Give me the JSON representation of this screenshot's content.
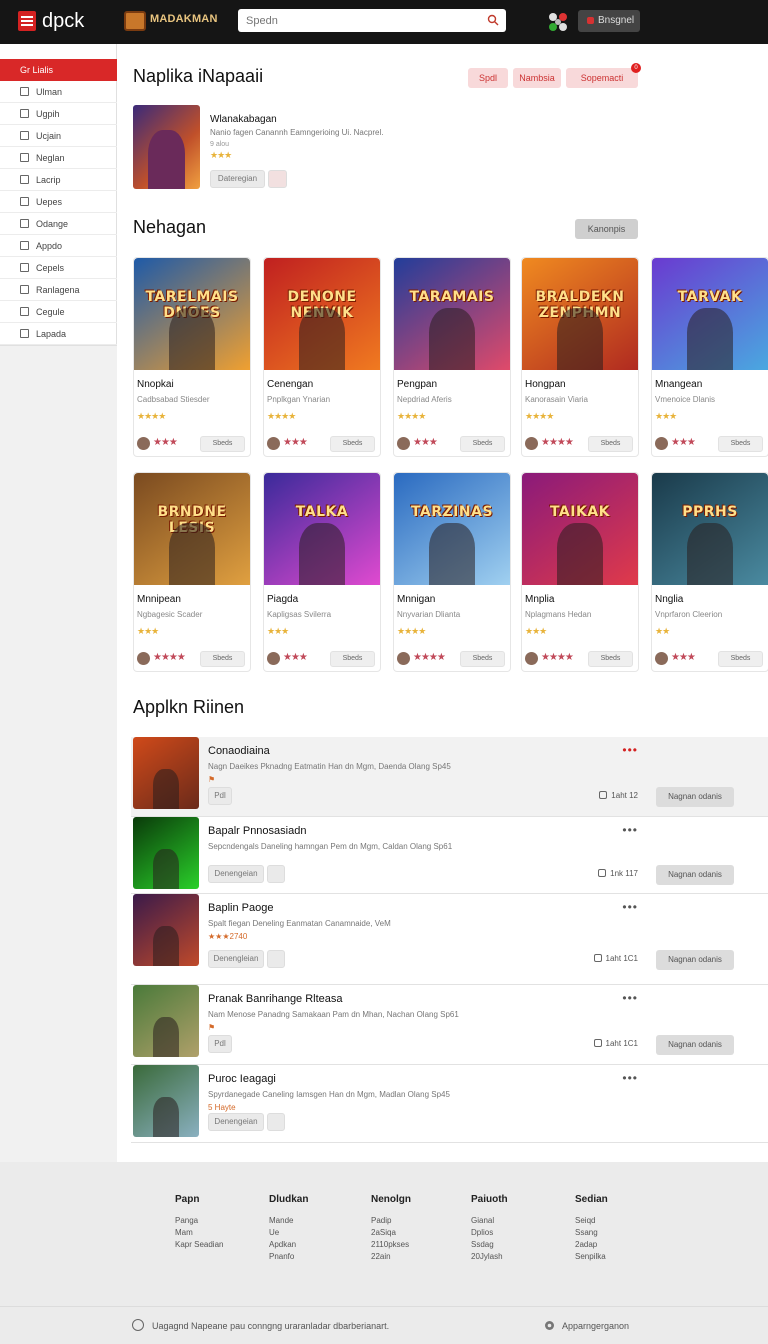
{
  "header": {
    "logo": "dpck",
    "brand": "MADAKMAN",
    "search_placeholder": "Spedn",
    "user_button": "Bnsgnel"
  },
  "sidebar": {
    "items": [
      {
        "label": "Gr Lialis",
        "icon": "flame-icon",
        "active": true
      },
      {
        "label": "Ulman",
        "icon": "loop-icon"
      },
      {
        "label": "Ugpih",
        "icon": "grid-icon"
      },
      {
        "label": "Ucjain",
        "icon": "box-icon"
      },
      {
        "label": "Neglan",
        "icon": "doc-icon"
      },
      {
        "label": "Lacrip",
        "icon": "square-icon"
      },
      {
        "label": "Uepes",
        "icon": "list-icon"
      },
      {
        "label": "Odange",
        "icon": "shield-icon"
      },
      {
        "label": "Appdo",
        "icon": "window-icon"
      },
      {
        "label": "Cepels",
        "icon": "gear-icon"
      },
      {
        "label": "Ranlagena",
        "icon": "table-icon"
      },
      {
        "label": "Cegule",
        "icon": "globe-icon"
      },
      {
        "label": "Lapada",
        "icon": "person-icon"
      }
    ]
  },
  "featured": {
    "title": "Naplika iNapaaii",
    "pills": [
      "Spdl",
      "Nambsia",
      "Sopemacti"
    ],
    "pill_badge": "0",
    "item": {
      "title": "Wlanakabagan",
      "desc": "Nanio fagen Canannh Eamngerioing Ui. Nacprel.",
      "meta": "9 alou",
      "stars": "★★★",
      "button": "Dateregian"
    }
  },
  "grid_section": {
    "title": "Nehagan",
    "button": "Kanonpis",
    "cards": [
      {
        "label": "TARELMAIS DNOES",
        "title": "Nnopkai",
        "sub": "Cadbsabad Stiesder",
        "stars": "★★★★",
        "foot_stars": "★★★",
        "btn": "Sbeds",
        "colors": [
          "#1e5aa8",
          "#f0a030"
        ]
      },
      {
        "label": "DENONE NENVIK",
        "title": "Cenengan",
        "sub": "Pnplkgan Ynarian",
        "stars": "★★★★",
        "foot_stars": "★★★",
        "btn": "Sbeds",
        "colors": [
          "#c02020",
          "#f07a20"
        ]
      },
      {
        "label": "TARAMAIS",
        "title": "Pengpan",
        "sub": "Nepdriad Aferis",
        "stars": "★★★★",
        "foot_stars": "★★★",
        "btn": "Sbeds",
        "colors": [
          "#223d9a",
          "#e04a6a"
        ]
      },
      {
        "label": "BRALDEKN ZENPHMN",
        "title": "Hongpan",
        "sub": "Kanorasain Viaria",
        "stars": "★★★★",
        "foot_stars": "★★★★",
        "btn": "Sbeds",
        "colors": [
          "#f08a20",
          "#b02a20"
        ]
      },
      {
        "label": "TARVAK",
        "title": "Mnangean",
        "sub": "Vmenoice Dlanis",
        "stars": "★★★",
        "foot_stars": "★★★",
        "btn": "Sbeds",
        "colors": [
          "#6a3ad0",
          "#4aa8e0"
        ]
      },
      {
        "label": "BRNDNE LESIS",
        "title": "Mnnipean",
        "sub": "Ngbagesic Scader",
        "stars": "★★★",
        "foot_stars": "★★★★",
        "btn": "Sbeds",
        "colors": [
          "#7a4a20",
          "#e0a040"
        ]
      },
      {
        "label": "TALKA",
        "title": "Piagda",
        "sub": "Kapligsas Svilerra",
        "stars": "★★★",
        "foot_stars": "★★★",
        "btn": "Sbeds",
        "colors": [
          "#3a2a9a",
          "#e04ad0"
        ]
      },
      {
        "label": "TARZINAS",
        "title": "Mnnigan",
        "sub": "Nnyvarian Dlianta",
        "stars": "★★★★",
        "foot_stars": "★★★★",
        "btn": "Sbeds",
        "colors": [
          "#2a6ac0",
          "#a0d0f0"
        ]
      },
      {
        "label": "TAIKAK",
        "title": "Mnplia",
        "sub": "Nplagmans Hedan",
        "stars": "★★★",
        "foot_stars": "★★★★",
        "btn": "Sbeds",
        "colors": [
          "#8a1a7a",
          "#e03a4a"
        ]
      },
      {
        "label": "PPRHS",
        "title": "Nnglia",
        "sub": "Vnprfaron Cleerion",
        "stars": "★★",
        "foot_stars": "★★★",
        "btn": "Sbeds",
        "colors": [
          "#1a3a4a",
          "#4a8aa0"
        ]
      }
    ]
  },
  "list_section": {
    "title": "Applkn Riinen",
    "rows": [
      {
        "title": "Conaodiaina",
        "desc": "Nagn Daeikes Pknadng Eatmatin Han dn Mgm, Daenda Olang Sp45",
        "meta": "⚑",
        "count": "1aht 12",
        "action": "Nagnan odanis",
        "small": "Pdl",
        "colors": [
          "#d04a1a",
          "#6a2a1a"
        ]
      },
      {
        "title": "Bapalr Pnnosasiadn",
        "desc": "Sepcndengals Daneling hamngan Pem dn Mgm, Caldan Olang Sp61",
        "meta": "",
        "count": "1nk 117",
        "action": "Nagnan odanis",
        "small": "Denengeian",
        "colors": [
          "#0a3a0a",
          "#2ad02a"
        ]
      },
      {
        "title": "Baplin Paoge",
        "desc": "Spalt fiegan Deneling Eanmatan Canamnaide, VeM",
        "meta": "★★★2740",
        "count": "1aht 1C1",
        "action": "Nagnan odanis",
        "small": "Denengleian",
        "colors": [
          "#3a1a4a",
          "#c04a2a"
        ]
      },
      {
        "title": "Pranak Banrihange Rlteasa",
        "desc": "Nam Menose Panadng Samakaan Pam dn Mhan, Nachan Olang Sp61",
        "meta": "⚑",
        "count": "1aht 1C1",
        "action": "Nagnan odanis",
        "small": "Pdl",
        "colors": [
          "#4a7a3a",
          "#b0a06a"
        ]
      },
      {
        "title": "Puroc Ieagagi",
        "desc": "Spyrdanegade Caneling Iamsgen Han dn Mgm, Madlan Olang Sp45",
        "meta": "5 Hayte",
        "count": "",
        "action": "",
        "small": "Denengeian",
        "colors": [
          "#3a6a3a",
          "#8ab0c0"
        ]
      }
    ]
  },
  "footer": {
    "columns": [
      {
        "head": "Papn",
        "links": [
          "Panga",
          "Mam",
          "Kapr Seadian"
        ]
      },
      {
        "head": "Dludkan",
        "links": [
          "Mande",
          "Ue",
          "Apdkan",
          "Pnanfo"
        ]
      },
      {
        "head": "Nenolgn",
        "links": [
          "Padip",
          "2aSiqa",
          "2110pkses",
          "22ain"
        ]
      },
      {
        "head": "Paiuoth",
        "links": [
          "Gianal",
          "Dplios",
          "Ssdag",
          "20Jylash"
        ]
      },
      {
        "head": "Sedian",
        "links": [
          "Seiqd",
          "Ssang",
          "2adap",
          "Senpilka"
        ]
      }
    ],
    "note": "Uagagnd Napeane pau conngng uraranladar dbarberianart.",
    "right_label": "Apparngerganon"
  }
}
